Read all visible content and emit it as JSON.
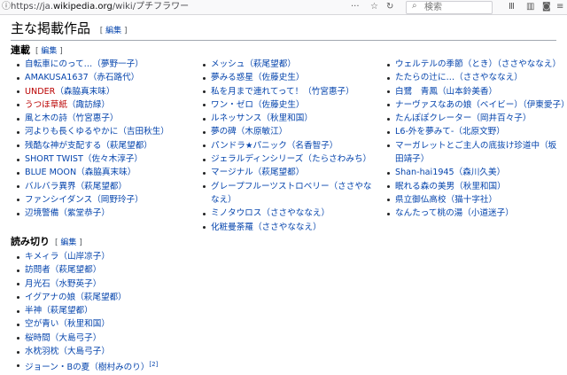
{
  "browser": {
    "url_prefix": "https://ja.",
    "url_host": "wikipedia.org",
    "url_path": "/wiki/プチフラワー",
    "more_glyph": "···",
    "search_placeholder": "検索"
  },
  "section": {
    "title": "主な掲載作品",
    "edit_label": "編集"
  },
  "serial": {
    "title": "連載",
    "edit_label": "編集",
    "col1": [
      {
        "t": "自転車にのって…",
        "a": "（夢野一子）"
      },
      {
        "t": "AMAKUSA1637",
        "a": "（赤石路代）"
      },
      {
        "t": "UNDER",
        "a": "（森脇真末味）",
        "red": true
      },
      {
        "t": "うつほ草紙",
        "a": "（諏訪緑）",
        "red": true
      },
      {
        "t": "風と木の詩",
        "a": "（竹宮惠子）"
      },
      {
        "t": "河よりも長くゆるやかに",
        "a": "（吉田秋生）"
      },
      {
        "t": "残酷な神が支配する",
        "a": "（萩尾望都）"
      },
      {
        "t": "SHORT TWIST",
        "a": "（佐々木淳子）"
      },
      {
        "t": "BLUE MOON",
        "a": "（森脇真末味）"
      },
      {
        "t": "バルバラ異界",
        "a": "（萩尾望都）"
      },
      {
        "t": "ファンシイダンス",
        "a": "（岡野玲子）"
      },
      {
        "t": "辺境警備",
        "a": "（紫堂恭子）"
      }
    ],
    "col2": [
      {
        "t": "メッシュ",
        "a": "（萩尾望都）"
      },
      {
        "t": "夢みる惑星",
        "a": "（佐藤史生）"
      },
      {
        "t": "私を月まで連れてって！",
        "a": "（竹宮惠子）"
      },
      {
        "t": "ワン・ゼロ",
        "a": "（佐藤史生）"
      },
      {
        "t": "ルネッサンス",
        "a": "（秋里和国）"
      },
      {
        "t": "夢の碑",
        "a": "（木原敏江）"
      },
      {
        "t": "パンドラ★パニック",
        "a": "（名香智子）"
      },
      {
        "t": "ジェラルディンシリーズ",
        "a": "（たらさわみち）"
      },
      {
        "t": "マージナル",
        "a": "（萩尾望都）"
      },
      {
        "t": "グレープフルーツストロベリー",
        "a": "（ささやななえ）",
        "wrap": true
      },
      {
        "t": "ミノタウロス",
        "a": "（ささやななえ）"
      },
      {
        "t": "化粧曼荼羅",
        "a": "（ささやななえ）"
      }
    ],
    "col3": [
      {
        "t": "ウェルテルの季節（とき）",
        "a": "（ささやななえ）"
      },
      {
        "t": "たたらの辻に…",
        "a": "（ささやななえ）"
      },
      {
        "t": "白鷺　青鳳",
        "a": "（山本鈴美香）"
      },
      {
        "t": "ナーヴァスなあの娘（ベイビー）",
        "a": "（伊東愛子）"
      },
      {
        "t": "たんぽぽクレーター",
        "a": "（岡井百々子）"
      },
      {
        "t": "L6-外を夢みて-",
        "a": "（北原文野）"
      },
      {
        "t": "マーガレットとご主人の底抜け珍道中",
        "a": "（坂田靖子）",
        "wrap": true
      },
      {
        "t": "Shan-hai1945",
        "a": "（森川久美）"
      },
      {
        "t": "眠れる森の美男",
        "a": "（秋里和国）"
      },
      {
        "t": "県立御仏高校",
        "a": "（猫十字社）"
      },
      {
        "t": "なんたって桃の湯",
        "a": "（小道迷子）"
      }
    ]
  },
  "oneshot": {
    "title": "読み切り",
    "edit_label": "編集",
    "items": [
      {
        "t": "キメィラ",
        "a": "（山岸凉子）"
      },
      {
        "t": "訪問者",
        "a": "（萩尾望都）"
      },
      {
        "t": "月光石",
        "a": "（水野英子）"
      },
      {
        "t": "イグアナの娘",
        "a": "（萩尾望都）"
      },
      {
        "t": "半神",
        "a": "（萩尾望都）"
      },
      {
        "t": "空が青い",
        "a": "（秋里和国）"
      },
      {
        "t": "桜時間",
        "a": "（大島弓子）"
      },
      {
        "t": "水枕羽枕",
        "a": "（大島弓子）"
      },
      {
        "t": "ジョーン・Bの夏",
        "a": "（樹村みのり）",
        "sup": "[2]"
      }
    ]
  }
}
